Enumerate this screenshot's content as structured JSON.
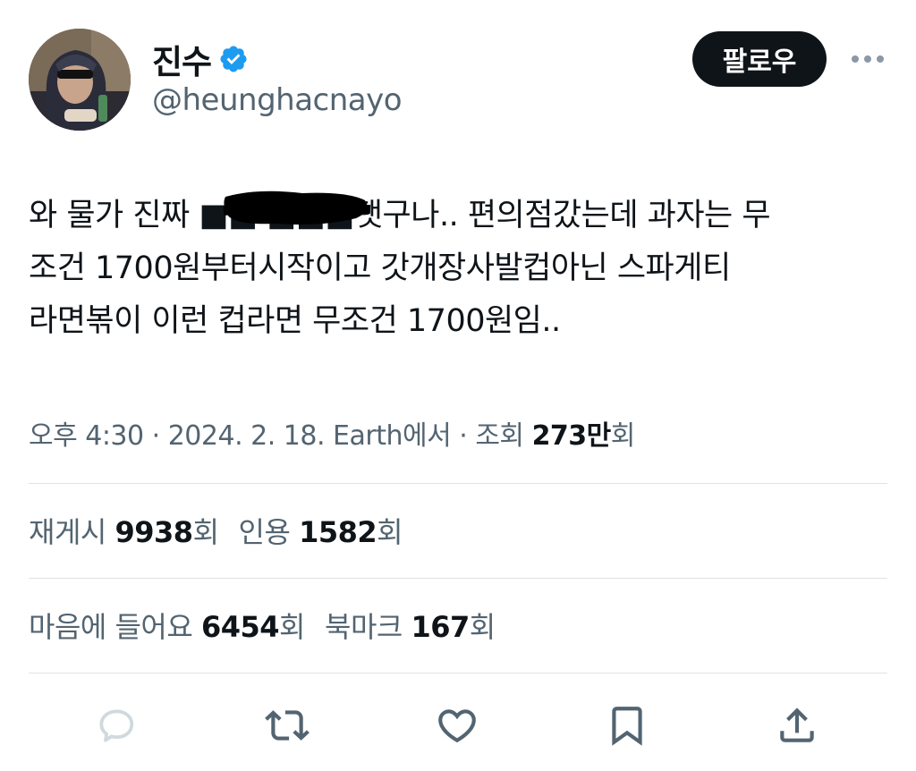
{
  "author": {
    "display_name": "진수",
    "handle": "@heunghacnayo",
    "verified": true,
    "avatar_icon": "profile-photo"
  },
  "follow_button": {
    "label": "팔로우"
  },
  "tweet": {
    "text": "와 물가 진짜 ■■ ■■■탯구나.. 편의점갔는데 과자는 무\n조건 1700원부터시작이고 갓개장사발컵아닌 스파게티\n라면볶이 이런 컵라면 무조건 1700원임..",
    "redacted": true
  },
  "meta": {
    "time": "오후 4:30",
    "separator1": " · ",
    "date": "2024. 2. 18.",
    "location": " Earth에서",
    "separator2": " · ",
    "views_label": "조회 ",
    "views_count": "273만",
    "views_suffix": "회"
  },
  "stats": {
    "retweets_label": "재게시 ",
    "retweets_count": "9938",
    "retweets_suffix": "회",
    "quotes_label": "인용 ",
    "quotes_count": "1582",
    "quotes_suffix": "회",
    "likes_label": "마음에 들어요 ",
    "likes_count": "6454",
    "likes_suffix": "회",
    "bookmarks_label": "북마크 ",
    "bookmarks_count": "167",
    "bookmarks_suffix": "회"
  },
  "actions": [
    {
      "icon": "reply-icon"
    },
    {
      "icon": "retweet-icon"
    },
    {
      "icon": "like-icon"
    },
    {
      "icon": "bookmark-icon"
    },
    {
      "icon": "share-icon"
    }
  ],
  "colors": {
    "text_primary": "#0f1419",
    "text_secondary": "#536471",
    "verified_blue": "#1d9bf0",
    "divider": "#dfe3e6",
    "button_bg": "#0f1419",
    "reply_icon": "#cfd9de"
  }
}
